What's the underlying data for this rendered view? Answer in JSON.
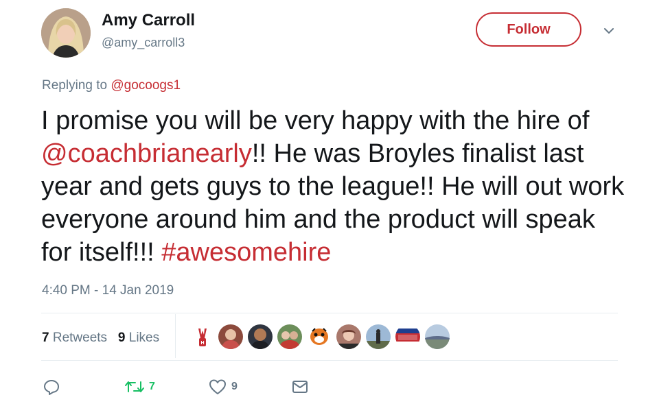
{
  "user": {
    "name": "Amy Carroll",
    "handle": "@amy_carroll3",
    "avatar_icon": "profile-photo"
  },
  "header": {
    "follow_label": "Follow",
    "menu_icon": "chevron-down-icon"
  },
  "reply": {
    "prefix": "Replying to ",
    "mention": "@gocoogs1"
  },
  "tweet": {
    "t1": "I promise you will be very happy with the hire of ",
    "mention": "@coachbrianearly",
    "t2": "!! He was Broyles finalist last year and gets guys to the league!! He will out work everyone around him and the product will speak for itself!!! ",
    "hashtag": "#awesomehire"
  },
  "timestamp": "4:40 PM - 14 Jan 2019",
  "stats": {
    "retweets_count": "7",
    "retweets_label": "Retweets",
    "likes_count": "9",
    "likes_label": "Likes"
  },
  "likers": [
    "liker-1",
    "liker-2",
    "liker-3",
    "liker-4",
    "liker-5",
    "liker-6",
    "liker-7",
    "liker-8",
    "liker-9"
  ],
  "actions": {
    "retweet_count": "7",
    "like_count": "9"
  },
  "colors": {
    "accent": "#c62d33",
    "retweet": "#17bf63",
    "muted": "#657786",
    "text": "#14171a"
  }
}
